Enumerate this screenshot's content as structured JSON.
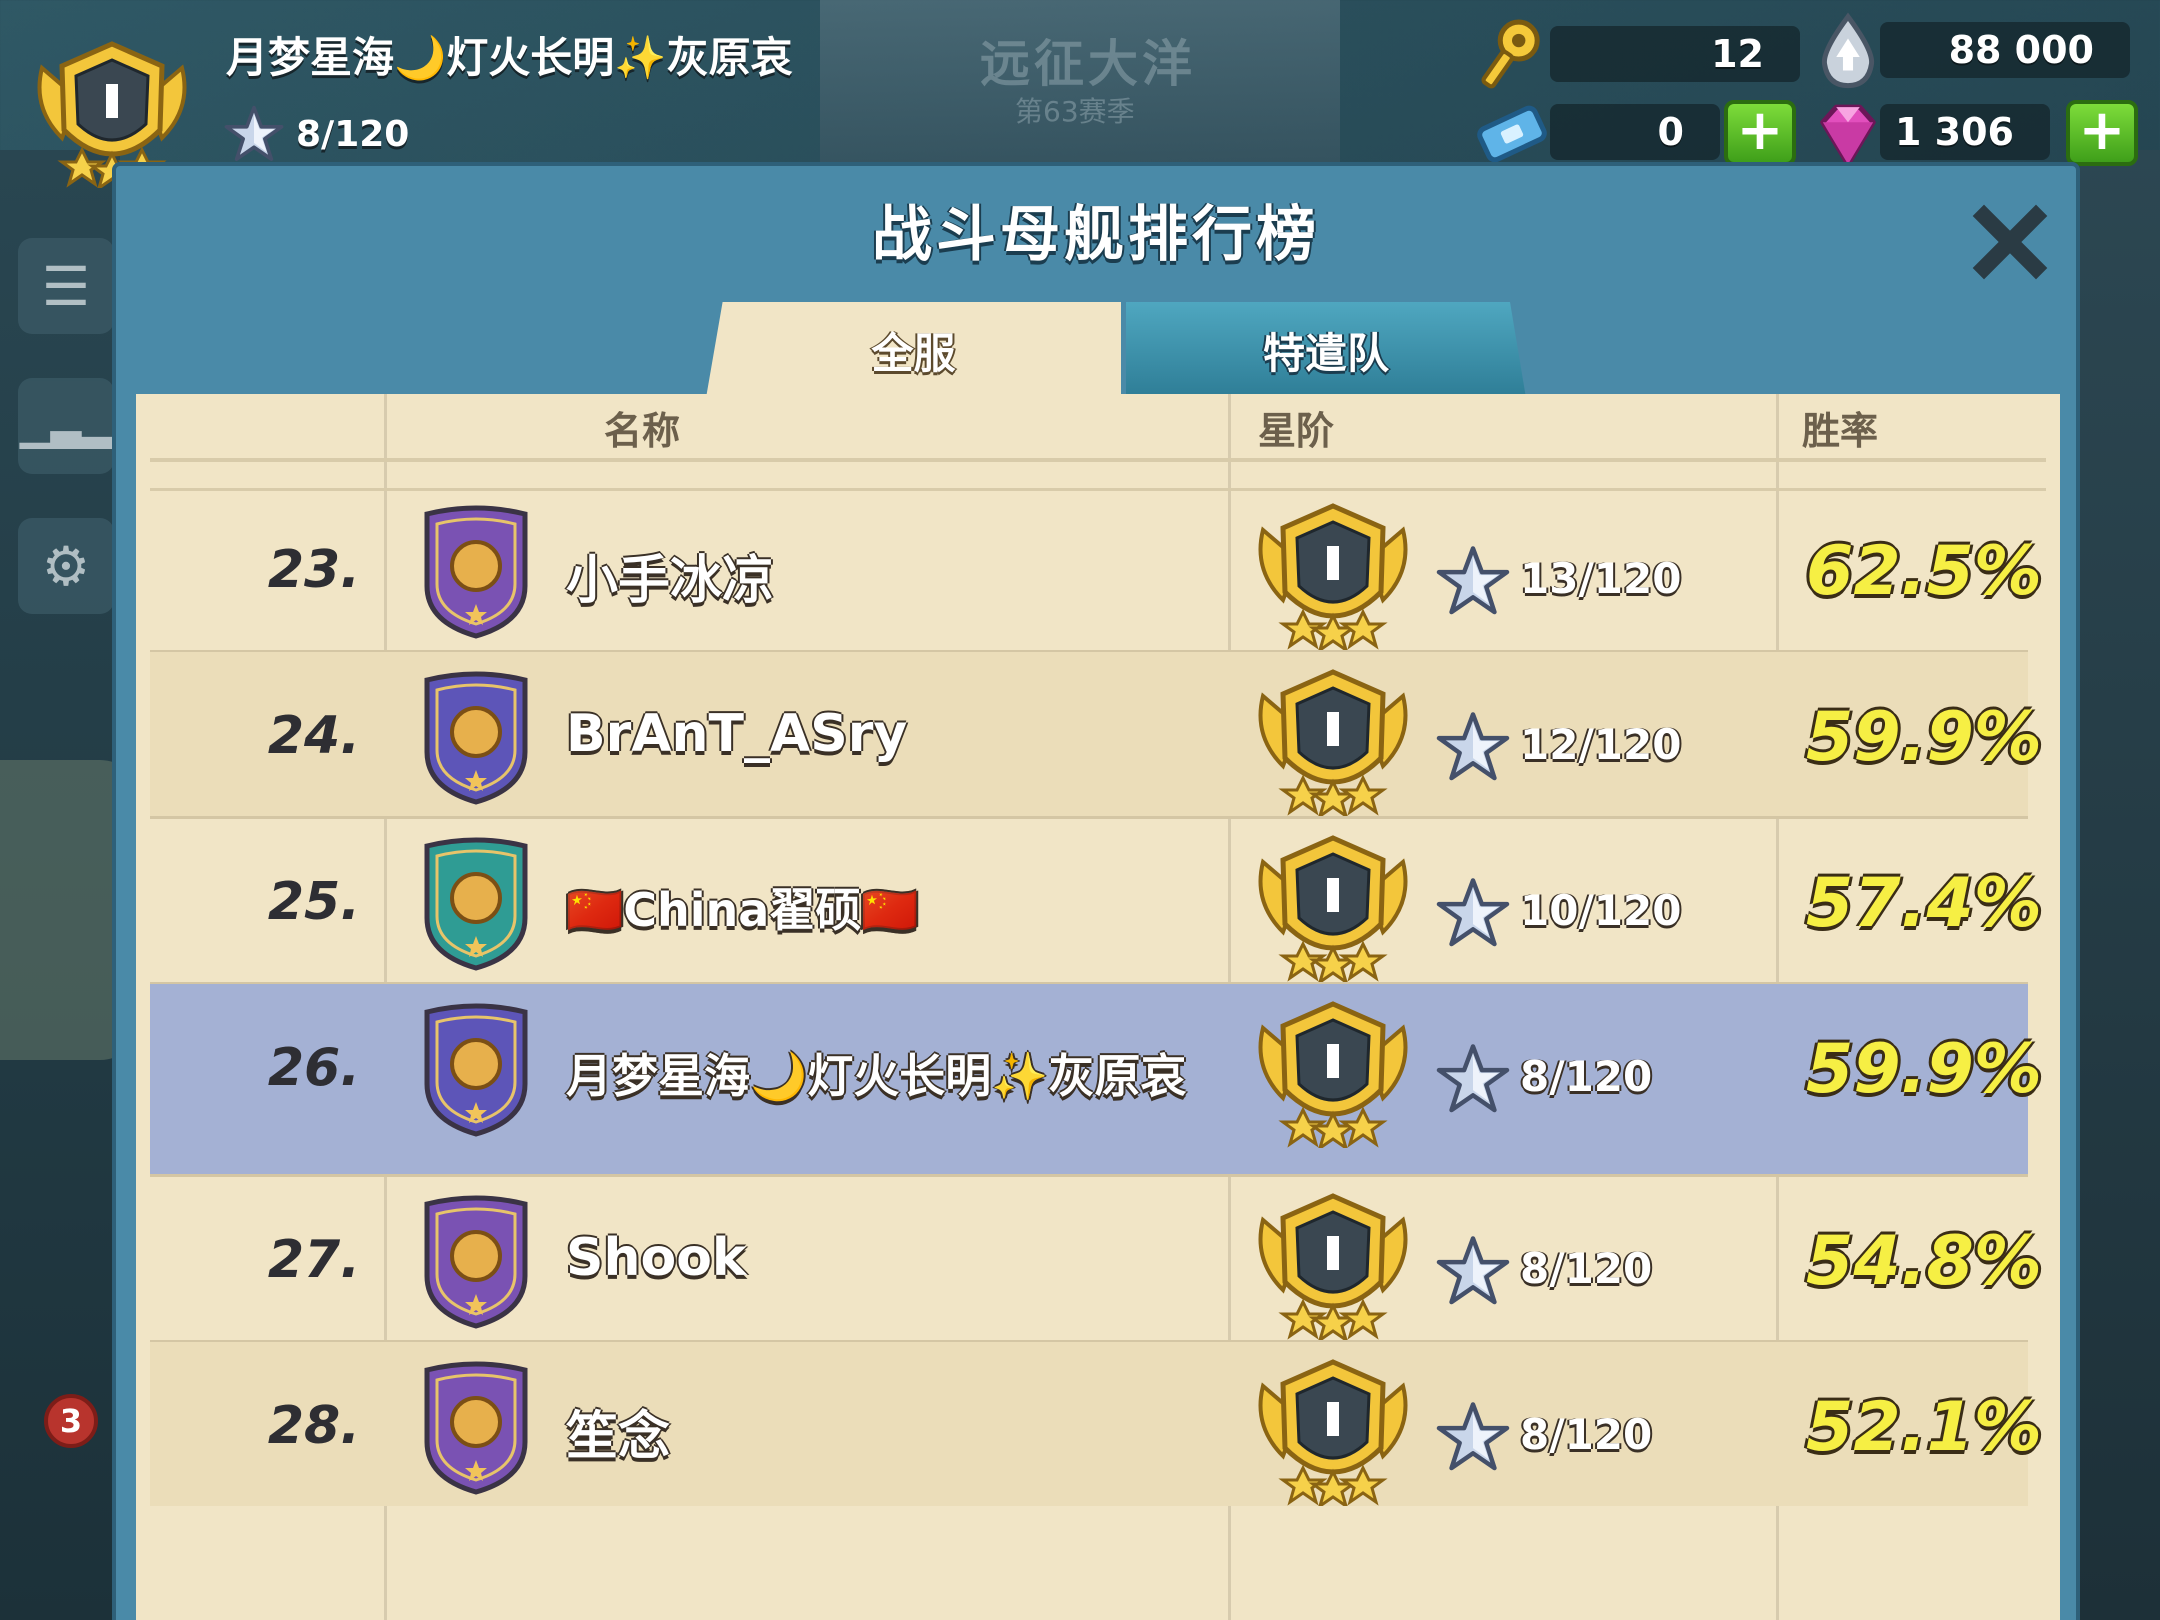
{
  "event": {
    "title": "远征大洋",
    "subtitle": "第63赛季"
  },
  "player": {
    "name": "月梦星海🌙灯火长明✨灰原哀",
    "rank_tier": "I",
    "stars": "8/120"
  },
  "resources": {
    "keys": "12",
    "intel": "88 000",
    "tickets": "0",
    "diamonds": "1 306"
  },
  "side_badge": "3",
  "panel": {
    "title": "战斗母舰排行榜",
    "tabs": {
      "all_servers": "全服",
      "task_force": "特遣队"
    },
    "active_tab": "全服",
    "columns": {
      "name": "名称",
      "rank": "星阶",
      "win_rate": "胜率"
    }
  },
  "rows": [
    {
      "rank": "23.",
      "name": "小手冰凉",
      "tier": "I",
      "stars": "13/120",
      "win_rate": "62.5%",
      "shield_color": "#7a52b3",
      "highlighted": false
    },
    {
      "rank": "24.",
      "name": "BrAnT_ASry",
      "tier": "I",
      "stars": "12/120",
      "win_rate": "59.9%",
      "shield_color": "#5d55b8",
      "highlighted": false
    },
    {
      "rank": "25.",
      "name": "🇨🇳China翟硕🇨🇳",
      "tier": "I",
      "stars": "10/120",
      "win_rate": "57.4%",
      "shield_color": "#2f9c94",
      "highlighted": false
    },
    {
      "rank": "26.",
      "name": "月梦星海🌙灯火长明✨灰原哀",
      "tier": "I",
      "stars": "8/120",
      "win_rate": "59.9%",
      "shield_color": "#5d55b8",
      "highlighted": true
    },
    {
      "rank": "27.",
      "name": "Shook",
      "tier": "I",
      "stars": "8/120",
      "win_rate": "54.8%",
      "shield_color": "#7a52b3",
      "highlighted": false
    },
    {
      "rank": "28.",
      "name": "笙念",
      "tier": "I",
      "stars": "8/120",
      "win_rate": "52.1%",
      "shield_color": "#7a52b3",
      "highlighted": false
    }
  ]
}
